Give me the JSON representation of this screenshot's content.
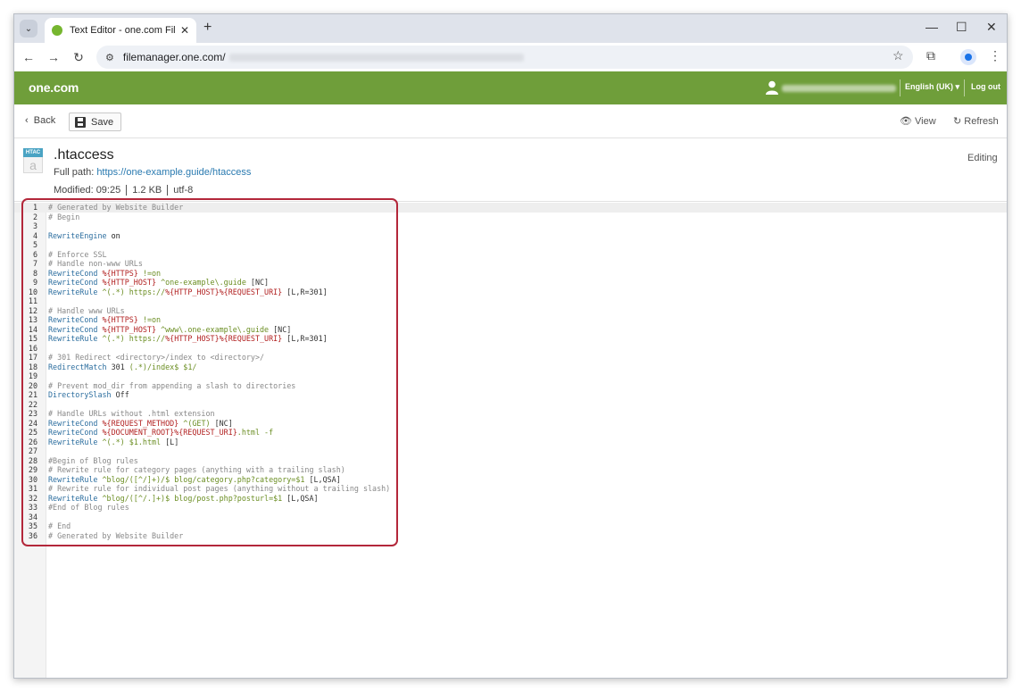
{
  "browser": {
    "tab_title": "Text Editor - one.com File Mana",
    "new_tab": "+",
    "url": "filemanager.one.com/"
  },
  "header": {
    "logo": "one.com",
    "language": "English (UK) ▾",
    "logout": "Log out",
    "accent": "#6f9e3a"
  },
  "actions": {
    "back": "Back",
    "save": "Save",
    "view": "View",
    "refresh": "Refresh"
  },
  "file": {
    "icon_tag": "HTAC",
    "name": ".htaccess",
    "full_path_label": "Full path:",
    "full_path": "https://one-example.guide/htaccess",
    "modified": "Modified:  09:25",
    "size": "1.2 KB",
    "encoding": "utf-8",
    "status": "Editing"
  },
  "editor": {
    "lines": [
      [
        {
          "t": "# Generated by Website Builder",
          "c": "#888888"
        }
      ],
      [
        {
          "t": "# Begin",
          "c": "#888888"
        }
      ],
      [],
      [
        {
          "t": "RewriteEngine",
          "c": "#2c6e9f"
        },
        {
          "t": " on",
          "c": "#222222"
        }
      ],
      [],
      [
        {
          "t": "# Enforce SSL",
          "c": "#888888"
        }
      ],
      [
        {
          "t": "# Handle non-www URLs",
          "c": "#888888"
        }
      ],
      [
        {
          "t": "RewriteCond",
          "c": "#2c6e9f"
        },
        {
          "t": " %{HTTPS}",
          "c": "#b22222"
        },
        {
          "t": " !=on",
          "c": "#6b8e23"
        }
      ],
      [
        {
          "t": "RewriteCond",
          "c": "#2c6e9f"
        },
        {
          "t": " %{HTTP_HOST}",
          "c": "#b22222"
        },
        {
          "t": " ^one-example\\.guide",
          "c": "#6b8e23"
        },
        {
          "t": " [NC]",
          "c": "#333333"
        }
      ],
      [
        {
          "t": "RewriteRule",
          "c": "#2c6e9f"
        },
        {
          "t": " ^(.*)",
          "c": "#6b8e23"
        },
        {
          "t": " https://",
          "c": "#6b8e23"
        },
        {
          "t": "%{HTTP_HOST}%{REQUEST_URI}",
          "c": "#b22222"
        },
        {
          "t": " [L,R=301]",
          "c": "#333333"
        }
      ],
      [],
      [
        {
          "t": "# Handle www URLs",
          "c": "#888888"
        }
      ],
      [
        {
          "t": "RewriteCond",
          "c": "#2c6e9f"
        },
        {
          "t": " %{HTTPS}",
          "c": "#b22222"
        },
        {
          "t": " !=on",
          "c": "#6b8e23"
        }
      ],
      [
        {
          "t": "RewriteCond",
          "c": "#2c6e9f"
        },
        {
          "t": " %{HTTP_HOST}",
          "c": "#b22222"
        },
        {
          "t": " ^www\\.one-example\\.guide",
          "c": "#6b8e23"
        },
        {
          "t": " [NC]",
          "c": "#333333"
        }
      ],
      [
        {
          "t": "RewriteRule",
          "c": "#2c6e9f"
        },
        {
          "t": " ^(.*)",
          "c": "#6b8e23"
        },
        {
          "t": " https://",
          "c": "#6b8e23"
        },
        {
          "t": "%{HTTP_HOST}%{REQUEST_URI}",
          "c": "#b22222"
        },
        {
          "t": " [L,R=301]",
          "c": "#333333"
        }
      ],
      [],
      [
        {
          "t": "# 301 Redirect <directory>/index to <directory>/",
          "c": "#888888"
        }
      ],
      [
        {
          "t": "RedirectMatch",
          "c": "#2c6e9f"
        },
        {
          "t": " 301",
          "c": "#333333"
        },
        {
          "t": " (.*)/index$",
          "c": "#6b8e23"
        },
        {
          "t": " $1/",
          "c": "#6b8e23"
        }
      ],
      [],
      [
        {
          "t": "# Prevent mod_dir from appending a slash to directories",
          "c": "#888888"
        }
      ],
      [
        {
          "t": "DirectorySlash",
          "c": "#2c6e9f"
        },
        {
          "t": " Off",
          "c": "#333333"
        }
      ],
      [],
      [
        {
          "t": "# Handle URLs without .html extension",
          "c": "#888888"
        }
      ],
      [
        {
          "t": "RewriteCond",
          "c": "#2c6e9f"
        },
        {
          "t": " %{REQUEST_METHOD}",
          "c": "#b22222"
        },
        {
          "t": " ^(GET)",
          "c": "#6b8e23"
        },
        {
          "t": " [NC]",
          "c": "#333333"
        }
      ],
      [
        {
          "t": "RewriteCond",
          "c": "#2c6e9f"
        },
        {
          "t": " %{DOCUMENT_ROOT}%{REQUEST_URI}",
          "c": "#b22222"
        },
        {
          "t": ".html -f",
          "c": "#6b8e23"
        }
      ],
      [
        {
          "t": "RewriteRule",
          "c": "#2c6e9f"
        },
        {
          "t": " ^(.*)",
          "c": "#6b8e23"
        },
        {
          "t": " $1.html",
          "c": "#6b8e23"
        },
        {
          "t": " [L]",
          "c": "#333333"
        }
      ],
      [],
      [
        {
          "t": "#Begin of Blog rules",
          "c": "#888888"
        }
      ],
      [
        {
          "t": "# Rewrite rule for category pages (anything with a trailing slash)",
          "c": "#888888"
        }
      ],
      [
        {
          "t": "RewriteRule",
          "c": "#2c6e9f"
        },
        {
          "t": " ^blog/([^/]+)/$",
          "c": "#6b8e23"
        },
        {
          "t": " blog/category.php?category=$1",
          "c": "#6b8e23"
        },
        {
          "t": " [L,QSA]",
          "c": "#333333"
        }
      ],
      [
        {
          "t": "# Rewrite rule for individual post pages (anything without a trailing slash)",
          "c": "#888888"
        }
      ],
      [
        {
          "t": "RewriteRule",
          "c": "#2c6e9f"
        },
        {
          "t": " ^blog/([^/.]+)$",
          "c": "#6b8e23"
        },
        {
          "t": " blog/post.php?posturl=$1",
          "c": "#6b8e23"
        },
        {
          "t": " [L,QSA]",
          "c": "#333333"
        }
      ],
      [
        {
          "t": "#End of Blog rules",
          "c": "#888888"
        }
      ],
      [],
      [
        {
          "t": "# End",
          "c": "#888888"
        }
      ],
      [
        {
          "t": "# Generated by Website Builder",
          "c": "#888888"
        }
      ]
    ]
  }
}
